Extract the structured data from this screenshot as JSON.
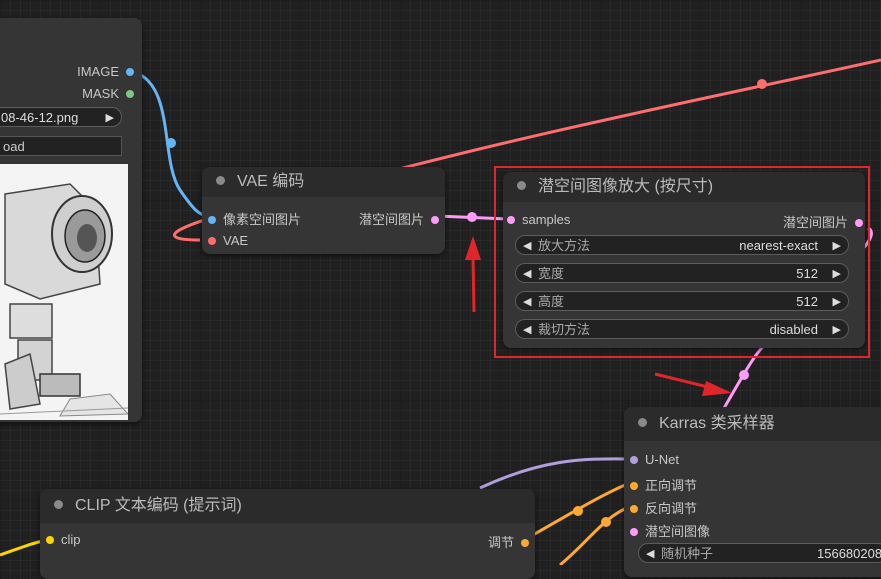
{
  "load_image": {
    "outputs": {
      "image": "IMAGE",
      "mask": "MASK"
    },
    "filename_value": "08-46-12.png",
    "upload_label": "oad"
  },
  "vae_encode": {
    "title": "VAE 编码",
    "inputs": {
      "pixels": "像素空间图片",
      "vae": "VAE"
    },
    "outputs": {
      "latent": "潜空间图片"
    }
  },
  "latent_upscale": {
    "title": "潜空间图像放大 (按尺寸)",
    "inputs": {
      "samples": "samples"
    },
    "outputs": {
      "latent": "潜空间图片"
    },
    "widgets": [
      {
        "label": "放大方法",
        "value": "nearest-exact"
      },
      {
        "label": "宽度",
        "value": "512"
      },
      {
        "label": "高度",
        "value": "512"
      },
      {
        "label": "裁切方法",
        "value": "disabled"
      }
    ]
  },
  "karras_sampler": {
    "title": "Karras 类采样器",
    "inputs": {
      "unet": "U-Net",
      "positive": "正向调节",
      "negative": "反向调节",
      "latent": "潜空间图像"
    },
    "widgets": [
      {
        "label": "随机种子",
        "value": "156680208"
      }
    ]
  },
  "clip_encode": {
    "title": "CLIP 文本编码 (提示词)",
    "inputs": {
      "clip": "clip"
    },
    "outputs": {
      "conditioning": "调节"
    }
  },
  "colors": {
    "background": "#202020",
    "node": "#353535",
    "image_pin": "#64b5f6",
    "mask_pin": "#81c784",
    "vae_pin": "#ff6e6e",
    "latent_pin": "#ff9cf9",
    "model_pin": "#b39ddb",
    "conditioning_pin": "#ffa931",
    "clip_pin": "#ffd500",
    "annotation": "#e0262a"
  },
  "icons": {
    "arrow_left": "◀",
    "arrow_right": "▶"
  }
}
